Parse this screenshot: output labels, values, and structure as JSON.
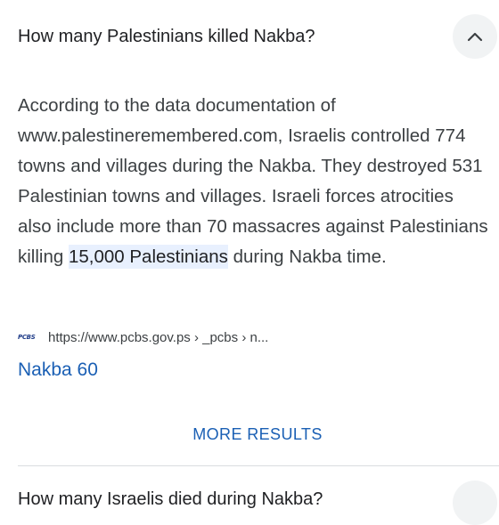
{
  "question": {
    "title": "How many Palestinians killed Nakba?"
  },
  "answer": {
    "text_before": "According to the data documentation of www.palestineremembered.com, Israelis controlled 774 towns and villages during the Nakba. They destroyed 531 Palestinian towns and villages. Israeli forces atrocities also include more than 70 massacres against Palestinians killing ",
    "highlight": "15,000 Palestinians",
    "text_after": " during Nakba time."
  },
  "source": {
    "favicon_text": "PCBS",
    "url": "https://www.pcbs.gov.ps › _pcbs › n...",
    "title": "Nakba 60"
  },
  "more_results_label": "MORE RESULTS",
  "next_question": {
    "title": "How many Israelis died during Nakba?"
  },
  "colors": {
    "link": "#1a5fb4",
    "highlight_bg": "#e8f0fe",
    "button_bg": "#f1f3f4"
  },
  "icons": {
    "collapse": "chevron-up-icon"
  }
}
